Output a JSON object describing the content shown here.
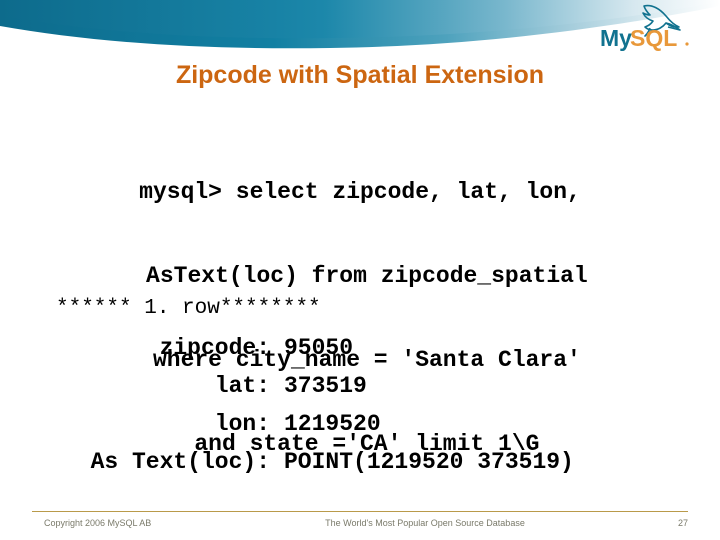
{
  "brand": {
    "name": "MySQL",
    "name_part1": "My",
    "name_part2": "SQL",
    "logo_icon": "dolphin-icon",
    "teal": "#11728f",
    "orange": "#e8983a"
  },
  "header": {
    "wave_color_dark": "#0d6b8c",
    "wave_color_light": "#ffffff"
  },
  "title": {
    "text": "Zipcode with Spatial Extension",
    "color": "#cc6611"
  },
  "query": {
    "lines": [
      "mysql> select zipcode, lat, lon,",
      " AsText(loc) from zipcode_spatial",
      " where city_name = 'Santa Clara'",
      " and state ='CA' limit 1\\G"
    ]
  },
  "result": {
    "row_header": "****** 1. row********",
    "rows": [
      {
        "label": "zipcode:",
        "value": "95050"
      },
      {
        "label": "lat:",
        "value": "373519"
      },
      {
        "label": "lon:",
        "value": "1219520"
      },
      {
        "label": "As Text(loc):",
        "value": "POINT(1219520 373519)"
      }
    ]
  },
  "footer": {
    "copyright": "Copyright 2006 MySQL AB",
    "tagline": "The World's Most Popular Open Source Database",
    "page_number": "27",
    "rule_color": "#b99a4a"
  }
}
